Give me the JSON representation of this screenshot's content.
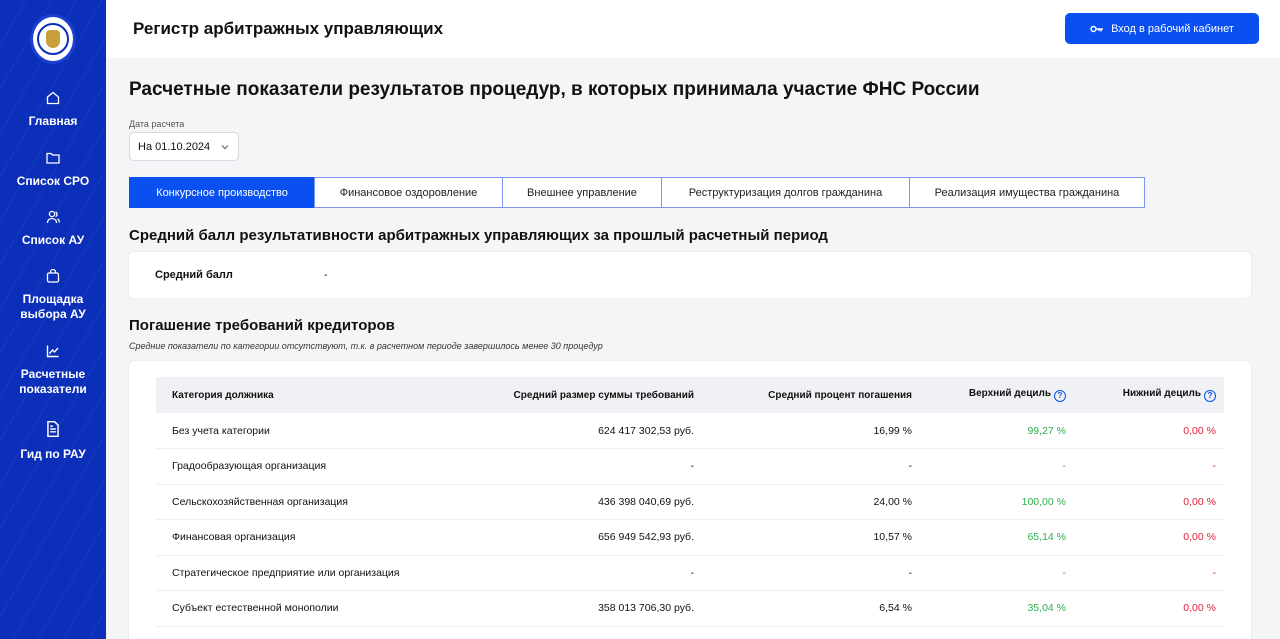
{
  "sidebar": {
    "items": [
      {
        "label": "Главная",
        "icon": "home-icon"
      },
      {
        "label": "Список СРО",
        "icon": "folder-icon"
      },
      {
        "label": "Список АУ",
        "icon": "users-icon"
      },
      {
        "label": "Площадка выбора АУ",
        "icon": "bag-icon"
      },
      {
        "label": "Расчетные показатели",
        "icon": "chart-icon",
        "active": true
      },
      {
        "label": "Гид по РАУ",
        "icon": "document-icon"
      }
    ]
  },
  "header": {
    "title": "Регистр арбитражных управляющих",
    "login_label": "Вход в рабочий кабинет"
  },
  "main": {
    "title": "Расчетные показатели результатов процедур, в которых принимала участие ФНС России",
    "date": {
      "label": "Дата расчета",
      "value": "На 01.10.2024"
    },
    "tabs": [
      {
        "label": "Конкурсное производство",
        "active": true
      },
      {
        "label": "Финансовое оздоровление"
      },
      {
        "label": "Внешнее управление"
      },
      {
        "label": "Реструктуризация долгов гражданина"
      },
      {
        "label": "Реализация имущества гражданина"
      }
    ],
    "avg_section": {
      "title": "Средний балл результативности арбитражных управляющих за прошлый расчетный период",
      "label": "Средний балл",
      "value": "-"
    },
    "repay_section": {
      "title": "Погашение требований кредиторов",
      "note": "Средние показатели по категории отсутствуют, т.к. в расчетном периоде завершилось менее 30 процедур",
      "columns": [
        "Категория должника",
        "Средний размер суммы требований",
        "Средний процент погашения",
        "Верхний дециль",
        "Нижний дециль"
      ],
      "rows": [
        [
          "Без учета категории",
          "624 417 302,53 руб.",
          "16,99 %",
          "99,27 %",
          "0,00 %"
        ],
        [
          "Градообразующая организация",
          "-",
          "-",
          "-",
          "-"
        ],
        [
          "Сельскохозяйственная организация",
          "436 398 040,69 руб.",
          "24,00 %",
          "100,00 %",
          "0,00 %"
        ],
        [
          "Финансовая организация",
          "656 949 542,93 руб.",
          "10,57 %",
          "65,14 %",
          "0,00 %"
        ],
        [
          "Стратегическое предприятие или организация",
          "-",
          "-",
          "-",
          "-"
        ],
        [
          "Субъект естественной монополии",
          "358 013 706,30 руб.",
          "6,54 %",
          "35,04 %",
          "0,00 %"
        ]
      ]
    }
  },
  "colors": {
    "accent": "#0a4ff0",
    "sidebar": "#0b2fb8",
    "positive": "#2fae4e",
    "negative": "#e0223a"
  }
}
